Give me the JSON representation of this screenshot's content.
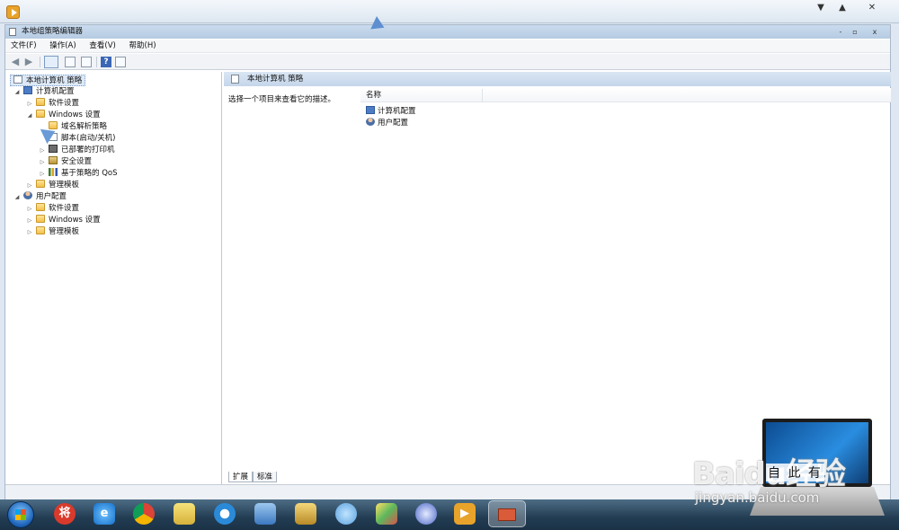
{
  "window": {
    "title": "本地组策略编辑器",
    "controls": {
      "minimize": "-",
      "restore": "▫",
      "close": "x"
    }
  },
  "outer_controls": {
    "down": "▼",
    "up": "▲",
    "close": "✕"
  },
  "menu": {
    "file": "文件(F)",
    "action": "操作(A)",
    "view": "查看(V)",
    "help": "帮助(H)"
  },
  "tree": {
    "root": "本地计算机 策略",
    "computer_config": "计算机配置",
    "cc_software": "软件设置",
    "cc_windows": "Windows 设置",
    "cc_dns": "域名解析策略",
    "cc_scripts": "脚本(启动/关机)",
    "cc_printers": "已部署的打印机",
    "cc_security": "安全设置",
    "cc_qos": "基于策略的 QoS",
    "cc_admin": "管理模板",
    "user_config": "用户配置",
    "uc_software": "软件设置",
    "uc_windows": "Windows 设置",
    "uc_admin": "管理模板"
  },
  "right_pane": {
    "header": "本地计算机 策略",
    "description": "选择一个项目来查看它的描述。",
    "column_name": "名称",
    "items": [
      "计算机配置",
      "用户配置"
    ]
  },
  "tabs": {
    "extended": "扩展",
    "standard": "标准"
  },
  "watermark": {
    "brand": "Baidu经验",
    "url": "jingyan.baidu.com",
    "laptop_text": "自 此 有"
  },
  "taskbar": {
    "icons": [
      "windows-start-icon",
      "jiang-app-icon",
      "ie-icon",
      "chrome-icon",
      "folder-app-icon",
      "browser-icon",
      "control-panel-icon",
      "file-manager-icon",
      "settings-icon",
      "paint-icon",
      "network-icon",
      "media-player-icon",
      "gpedit-icon"
    ]
  }
}
